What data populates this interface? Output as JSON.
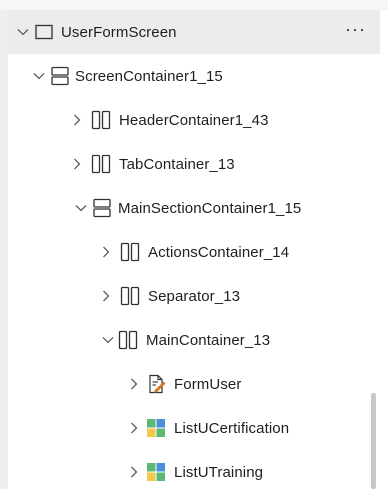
{
  "tree": {
    "items": [
      {
        "label": "UserFormScreen"
      },
      {
        "label": "ScreenContainer1_15"
      },
      {
        "label": "HeaderContainer1_43"
      },
      {
        "label": "TabContainer_13"
      },
      {
        "label": "MainSectionContainer1_15"
      },
      {
        "label": "ActionsContainer_14"
      },
      {
        "label": "Separator_13"
      },
      {
        "label": "MainContainer_13"
      },
      {
        "label": "FormUser"
      },
      {
        "label": "ListUCertification"
      },
      {
        "label": "ListUTraining"
      }
    ],
    "more_label": "···"
  },
  "icons": {
    "expanded": "chevron-down-icon",
    "collapsed": "chevron-right-icon",
    "screen": "screen-icon",
    "vertical_container": "vertical-container-icon",
    "horizontal_container": "horizontal-container-icon",
    "form": "form-icon",
    "gallery": "gallery-icon"
  },
  "colors": {
    "selected_row": "#ececec",
    "gallery_green": "#5bb974",
    "gallery_blue": "#4a90d9",
    "gallery_yellow": "#f2c94c",
    "form_orange": "#e67e22"
  }
}
